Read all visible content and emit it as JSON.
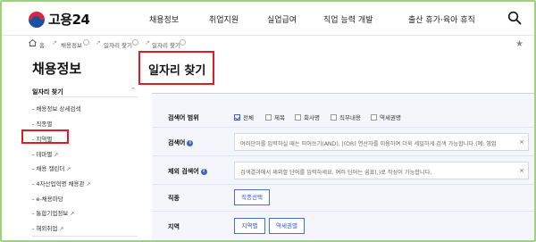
{
  "header": {
    "logo_text": "고용24",
    "nav": [
      "채용정보",
      "취업지원",
      "실업급여",
      "직업 능력 개발",
      "출산 휴가·육아 휴직"
    ]
  },
  "breadcrumb": {
    "items": [
      "홈",
      "채용정보",
      "일자리 찾기",
      "일자리 찾기"
    ]
  },
  "sidebar": {
    "title": "채용정보",
    "section": "일자리 찾기",
    "items": [
      {
        "label": "- 채용정보 상세검색",
        "external": false
      },
      {
        "label": "- 직종별",
        "external": false
      },
      {
        "label": "- 지역별",
        "external": false
      },
      {
        "label": "- 테마별",
        "external": true
      },
      {
        "label": "- 채용 캘린더",
        "external": true
      },
      {
        "label": "- 4차산업혁명 채용관",
        "external": true
      },
      {
        "label": "- e-채용마당",
        "external": false
      },
      {
        "label": "- 통합기업정보",
        "external": true
      },
      {
        "label": "- 해외취업",
        "external": true
      }
    ]
  },
  "main": {
    "title": "일자리 찾기",
    "form": {
      "scope_label": "검색어 범위",
      "scope_options": [
        {
          "label": "전체",
          "checked": true
        },
        {
          "label": "제목",
          "checked": false
        },
        {
          "label": "회사명",
          "checked": false
        },
        {
          "label": "직무내용",
          "checked": false
        },
        {
          "label": "역세권명",
          "checked": false
        }
      ],
      "keyword_label": "검색어",
      "keyword_placeholder": "여러단어를 입력하실 때는 띄어쓰기(AND), |(OR) 연산자를 이용하여 더욱 세밀하게 검색 가능합니다.(예: 영업",
      "exclude_label": "제외 검색어",
      "exclude_placeholder": "검색결과에서 제외할 단어를 입력하세요. 여러 단어는 쉼표(,)로 작성이 가능합니다.",
      "job_label": "직종",
      "job_button": "직종선택",
      "region_label": "지역",
      "region_button": "지역별",
      "station_button": "역세권별"
    }
  },
  "icons": {
    "search": "search-icon",
    "home": "home-icon",
    "star": "star-icon",
    "info": "info-icon",
    "close": "close-icon",
    "external": "external-link-icon"
  },
  "colors": {
    "highlight": "#e11b22",
    "accent": "#3e63c8",
    "frame": "#9fd37a"
  },
  "glyphs": {
    "chevron": "⌃",
    "star": "★",
    "info": "i",
    "clear": "×",
    "ext": "↗"
  }
}
